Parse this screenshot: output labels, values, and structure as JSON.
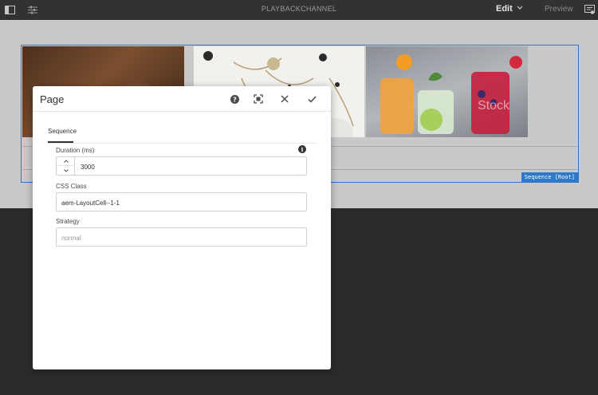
{
  "topbar": {
    "title": "PLAYBACKCHANNEL",
    "edit_label": "Edit",
    "preview_label": "Preview",
    "icons": [
      "sidebar-toggle-icon",
      "properties-icon",
      "chevron-down-icon",
      "annotations-icon"
    ]
  },
  "sequence": {
    "badge": "Sequence [Root]",
    "stock_watermark": "Stock",
    "accent_color": "#2d78c8"
  },
  "dialog": {
    "title": "Page",
    "icons": [
      "help-icon",
      "fullscreen-icon",
      "close-icon",
      "done-icon"
    ],
    "tab": "Sequence",
    "fields": {
      "duration": {
        "label": "Duration (ms)",
        "value": "3000"
      },
      "css_class": {
        "label": "CSS Class",
        "value": "aem-LayoutCell--1-1"
      },
      "strategy": {
        "label": "Strategy",
        "placeholder": "normal"
      }
    }
  }
}
